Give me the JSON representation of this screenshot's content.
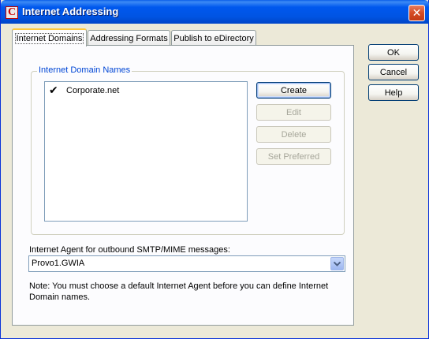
{
  "window": {
    "title": "Internet Addressing",
    "icon_letter": "C",
    "close_glyph": "✕"
  },
  "tabs": [
    {
      "label": "Internet Domains",
      "active": true
    },
    {
      "label": "Addressing Formats",
      "active": false
    },
    {
      "label": "Publish to eDirectory",
      "active": false
    }
  ],
  "domain_group": {
    "label": "Internet Domain Names",
    "items": [
      {
        "checked": true,
        "check_glyph": "✔",
        "name": "Corporate.net"
      }
    ],
    "buttons": {
      "create": "Create",
      "edit": "Edit",
      "delete": "Delete",
      "set_preferred": "Set Preferred"
    }
  },
  "agent": {
    "label": "Internet Agent for outbound SMTP/MIME messages:",
    "selected": "Provo1.GWIA"
  },
  "note": "Note:  You must choose a default Internet Agent before you can define Internet Domain names.",
  "dialog_buttons": {
    "ok": "OK",
    "cancel": "Cancel",
    "help": "Help"
  }
}
